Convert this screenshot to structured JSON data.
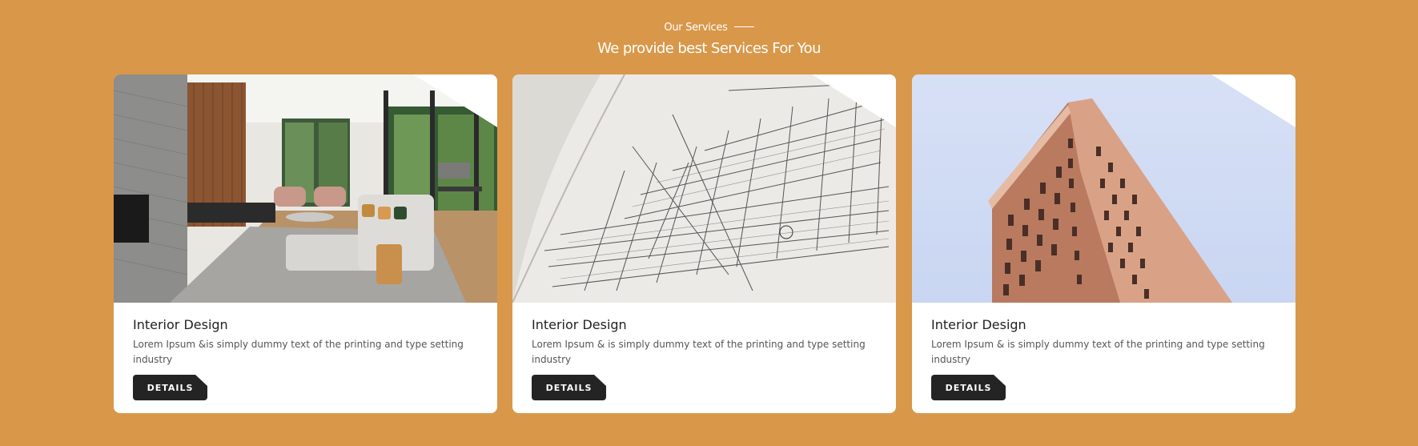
{
  "section": {
    "eyebrow": "Our Services",
    "title": "We provide best Services For You"
  },
  "cards": [
    {
      "title": "Interior Design",
      "description": "Lorem Ipsum &is simply dummy text of the printing and type setting industry",
      "button_label": "DETAILS",
      "image": "living-room-photo"
    },
    {
      "title": "Interior Design",
      "description": "Lorem Ipsum & is simply dummy text of the printing and type setting industry",
      "button_label": "DETAILS",
      "image": "blueprint-photo"
    },
    {
      "title": "Interior Design",
      "description": "Lorem Ipsum & is simply dummy text of the printing and type setting industry",
      "button_label": "DETAILS",
      "image": "flatiron-building-photo"
    }
  ],
  "colors": {
    "background": "#d9974a",
    "card": "#ffffff",
    "button": "#242424"
  }
}
